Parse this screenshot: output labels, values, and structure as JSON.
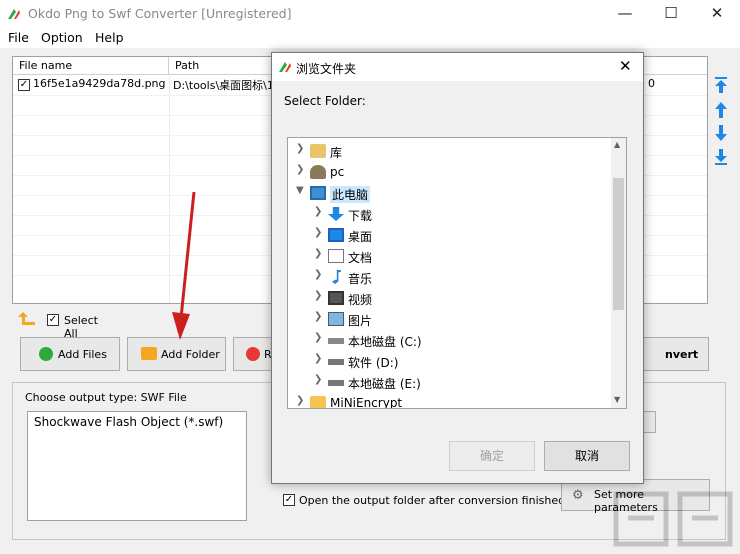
{
  "window": {
    "title": "Okdo Png to Swf Converter [Unregistered]"
  },
  "menu": [
    "File",
    "Option",
    "Help"
  ],
  "file_list": {
    "columns": [
      "File name",
      "Path"
    ],
    "rows": [
      {
        "name": "16f5e1a9429da78d.png",
        "path": "D:\\tools\\桌面图标\\1",
        "tail": "0",
        "checked": true
      }
    ]
  },
  "select_all_label": "Select All",
  "buttons": {
    "add_files": "Add Files",
    "add_folder": "Add Folder",
    "remove_prefix": "R",
    "convert_suffix": "nvert",
    "more_params": "Set more parameters"
  },
  "output": {
    "type_label": "Choose output type:  SWF File",
    "type_option": "Shockwave Flash Object (*.swf)",
    "open_folder_label": "Open the output folder after conversion finished"
  },
  "dialog": {
    "title": "浏览文件夹",
    "prompt": "Select Folder:",
    "tree": [
      {
        "label": "库",
        "icon": "library-icon",
        "indent": 0
      },
      {
        "label": "pc",
        "icon": "user-icon",
        "indent": 0
      },
      {
        "label": "此电脑",
        "icon": "computer-icon",
        "indent": 0,
        "expanded": true,
        "selected": true
      },
      {
        "label": "下载",
        "icon": "download-folder-icon",
        "indent": 1
      },
      {
        "label": "桌面",
        "icon": "desktop-folder-icon",
        "indent": 1
      },
      {
        "label": "文档",
        "icon": "documents-folder-icon",
        "indent": 1
      },
      {
        "label": "音乐",
        "icon": "music-folder-icon",
        "indent": 1
      },
      {
        "label": "视频",
        "icon": "video-folder-icon",
        "indent": 1
      },
      {
        "label": "图片",
        "icon": "pictures-folder-icon",
        "indent": 1
      },
      {
        "label": "本地磁盘 (C:)",
        "icon": "drive-c-icon",
        "indent": 1
      },
      {
        "label": "软件 (D:)",
        "icon": "drive-icon",
        "indent": 1
      },
      {
        "label": "本地磁盘 (E:)",
        "icon": "drive-icon",
        "indent": 1
      },
      {
        "label": "MiNiEncrypt",
        "icon": "folder-icon",
        "indent": 0
      }
    ],
    "ok_label": "确定",
    "cancel_label": "取消"
  },
  "colors": {
    "selection": "#cce8ff",
    "accent_blue": "#1e88e5",
    "arrow_red": "#cc1f1f",
    "add_green": "#2eaa3c",
    "folder_orange": "#f5a623"
  }
}
